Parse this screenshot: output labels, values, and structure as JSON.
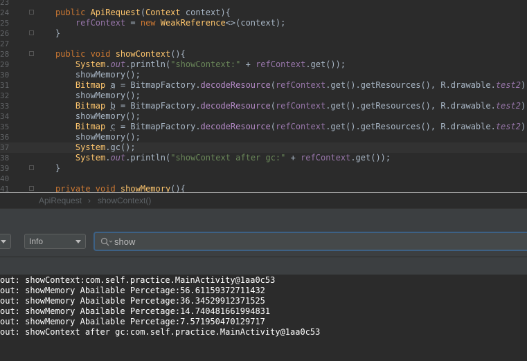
{
  "editor": {
    "lines": [
      {
        "num": "23",
        "tokens": []
      },
      {
        "num": "24",
        "tokens": [
          [
            "kw",
            "public "
          ],
          [
            "mth",
            "ApiRequest"
          ],
          [
            "cls",
            "("
          ],
          [
            "ycls",
            "Context"
          ],
          [
            "cls",
            " context){"
          ]
        ]
      },
      {
        "num": "25",
        "tokens": [
          [
            "cls",
            "    "
          ],
          [
            "ifld",
            "refContext"
          ],
          [
            "cls",
            " = "
          ],
          [
            "kw",
            "new "
          ],
          [
            "ycls",
            "WeakReference"
          ],
          [
            "cls",
            "<>(context);"
          ]
        ]
      },
      {
        "num": "26",
        "tokens": [
          [
            "cls",
            "}"
          ]
        ]
      },
      {
        "num": "27",
        "tokens": []
      },
      {
        "num": "28",
        "tokens": [
          [
            "kw",
            "public void "
          ],
          [
            "mth",
            "showContext"
          ],
          [
            "cls",
            "(){"
          ]
        ]
      },
      {
        "num": "29",
        "tokens": [
          [
            "cls",
            "    "
          ],
          [
            "ycls",
            "System"
          ],
          [
            "cls",
            "."
          ],
          [
            "fld",
            "out"
          ],
          [
            "cls",
            ".println("
          ],
          [
            "str",
            "\"showContext:\""
          ],
          [
            "cls",
            " + "
          ],
          [
            "ifld",
            "refContext"
          ],
          [
            "cls",
            ".get());"
          ]
        ]
      },
      {
        "num": "30",
        "tokens": [
          [
            "cls",
            "    showMemory();"
          ]
        ]
      },
      {
        "num": "31",
        "tokens": [
          [
            "cls",
            "    "
          ],
          [
            "ycls",
            "Bitmap "
          ],
          [
            "unused",
            "a"
          ],
          [
            "cls",
            " = BitmapFactory."
          ],
          [
            "api",
            "decodeResource"
          ],
          [
            "cls",
            "("
          ],
          [
            "ifld",
            "refContext"
          ],
          [
            "cls",
            ".get().getResources(), R.drawable."
          ],
          [
            "fld",
            "test2"
          ],
          [
            "cls",
            ");"
          ]
        ]
      },
      {
        "num": "32",
        "tokens": [
          [
            "cls",
            "    showMemory();"
          ]
        ]
      },
      {
        "num": "33",
        "tokens": [
          [
            "cls",
            "    "
          ],
          [
            "ycls",
            "Bitmap "
          ],
          [
            "unused",
            "b"
          ],
          [
            "cls",
            " = BitmapFactory."
          ],
          [
            "api",
            "decodeResource"
          ],
          [
            "cls",
            "("
          ],
          [
            "ifld",
            "refContext"
          ],
          [
            "cls",
            ".get().getResources(), R.drawable."
          ],
          [
            "fld",
            "test2"
          ],
          [
            "cls",
            ");"
          ]
        ]
      },
      {
        "num": "34",
        "tokens": [
          [
            "cls",
            "    showMemory();"
          ]
        ]
      },
      {
        "num": "35",
        "tokens": [
          [
            "cls",
            "    "
          ],
          [
            "ycls",
            "Bitmap "
          ],
          [
            "unused",
            "c"
          ],
          [
            "cls",
            " = BitmapFactory."
          ],
          [
            "api",
            "decodeResource"
          ],
          [
            "cls",
            "("
          ],
          [
            "ifld",
            "refContext"
          ],
          [
            "cls",
            ".get().getResources(), R.drawable."
          ],
          [
            "fld",
            "test2"
          ],
          [
            "cls",
            ");"
          ]
        ]
      },
      {
        "num": "36",
        "tokens": [
          [
            "cls",
            "    showMemory();"
          ]
        ]
      },
      {
        "num": "37",
        "tokens": [
          [
            "cls",
            "    "
          ],
          [
            "ycls",
            "System"
          ],
          [
            "cls",
            "."
          ],
          [
            "mcall",
            "gc"
          ],
          [
            "cls",
            "();"
          ]
        ]
      },
      {
        "num": "38",
        "tokens": [
          [
            "cls",
            "    "
          ],
          [
            "ycls",
            "System"
          ],
          [
            "cls",
            "."
          ],
          [
            "fld",
            "out"
          ],
          [
            "cls",
            ".println("
          ],
          [
            "str",
            "\"showContext after gc:\""
          ],
          [
            "cls",
            " + "
          ],
          [
            "ifld",
            "refContext"
          ],
          [
            "cls",
            ".get());"
          ]
        ]
      },
      {
        "num": "39",
        "tokens": [
          [
            "cls",
            "}"
          ]
        ]
      },
      {
        "num": "40",
        "tokens": []
      },
      {
        "num": "41",
        "tokens": [
          [
            "kw",
            "private void "
          ],
          [
            "mth",
            "showMemory"
          ],
          [
            "cls",
            "(){"
          ]
        ]
      }
    ],
    "current_line": "37"
  },
  "breadcrumb": {
    "class_name": "ApiRequest",
    "separator": "›",
    "method_name": "showContext()"
  },
  "logcat": {
    "level_dropdown": {
      "value": "Info"
    },
    "search": {
      "value": "show"
    },
    "lines": [
      "out: showContext:com.self.practice.MainActivity@1aa0c53",
      "out: showMemory Abailable Percetage:56.61159372711432",
      "out: showMemory Abailable Percetage:36.34529912371525",
      "out: showMemory Abailable Percetage:14.740481661994831",
      "out: showMemory Abailable Percetage:7.571950470129717",
      "out: showContext after gc:com.self.practice.MainActivity@1aa0c53"
    ]
  },
  "colors": {
    "editor_bg": "#2b2b2b",
    "panel_bg": "#3c3f41",
    "keyword": "#cc7832",
    "string": "#6a8759",
    "field": "#9876aa",
    "method": "#ffc66d",
    "focus_border": "#3d6185"
  }
}
